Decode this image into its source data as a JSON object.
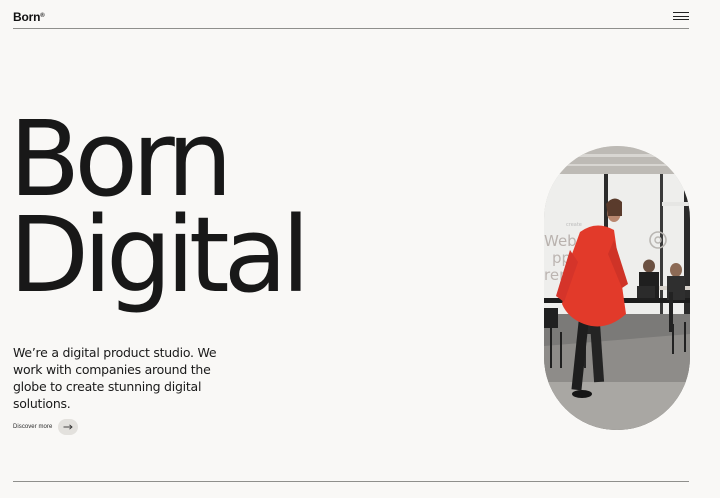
{
  "header": {
    "logo": "Born",
    "logo_mark": "®",
    "menu_icon": "hamburger-menu-icon"
  },
  "hero": {
    "title_line_1": "Born",
    "title_line_2": "Digital",
    "tagline": "We’re a digital product studio. We work with companies around the globe to create stunning digital solutions.",
    "cta_label": "Discover more",
    "cta_icon": "arrow-right-icon"
  },
  "photo": {
    "wall_text_line_1": "Websit",
    "wall_text_line_2": "pps",
    "wall_text_line_3": "rends",
    "wall_small_text": "create",
    "wall_icon": "at-sign-icon"
  },
  "colors": {
    "background": "#f9f8f6",
    "text": "#181818",
    "rule": "#8f8f8c",
    "cta_circle": "#e3e1dd",
    "coat": "#e23a2a"
  }
}
